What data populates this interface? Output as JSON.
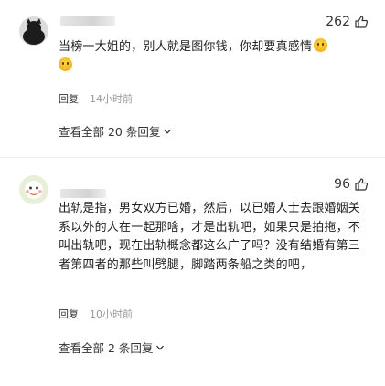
{
  "comments": [
    {
      "likes": "262",
      "text": "当榜一大姐的，别人就是图你钱，你却要真感情",
      "emoji": "smile-emoji",
      "reply_label": "回复",
      "time": "14小时前",
      "view_replies": "查看全部 20 条回复"
    },
    {
      "likes": "96",
      "text": "出轨是指，男女双方已婚，然后，以已婚人士去跟婚姻关系以外的人在一起那啥，才是出轨吧，如果只是拍拖，不叫出轨吧，现在出轨概念都这么广了吗？没有结婚有第三者第四者的那些叫劈腿，脚踏两条船之类的吧，",
      "reply_label": "回复",
      "time": "10小时前",
      "view_replies": "查看全部 2 条回复"
    }
  ],
  "colors": {
    "time": "#999999",
    "text": "#222222"
  },
  "icons": {
    "like": "thumbs-up-icon",
    "expand": "chevron-down-icon"
  }
}
